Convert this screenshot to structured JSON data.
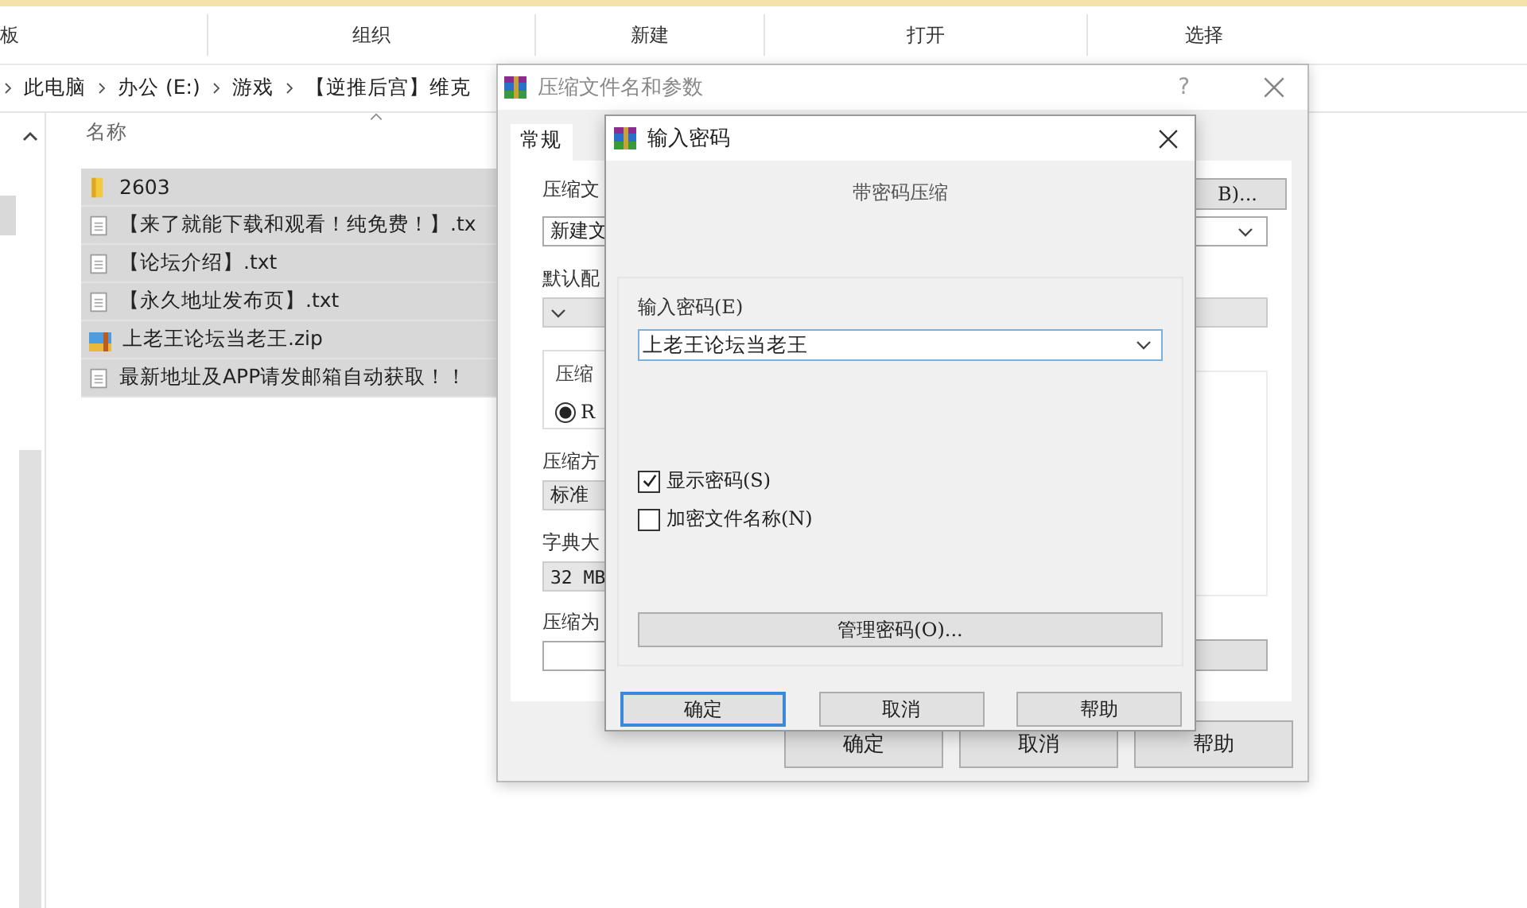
{
  "explorer": {
    "ribbon_groups": [
      "板",
      "组织",
      "新建",
      "打开",
      "选择"
    ],
    "breadcrumb": [
      "此电脑",
      "办公 (E:)",
      "游戏",
      "【逆推后宫】维克"
    ],
    "column_header": "名称",
    "files": [
      {
        "name": "2603",
        "kind": "folder",
        "selected": true
      },
      {
        "name": "【来了就能下载和观看！纯免费！】.tx",
        "kind": "text",
        "selected": true
      },
      {
        "name": "【论坛介绍】.txt",
        "kind": "text",
        "selected": true
      },
      {
        "name": "【永久地址发布页】.txt",
        "kind": "text",
        "selected": true
      },
      {
        "name": "上老王论坛当老王.zip",
        "kind": "archive",
        "selected": true
      },
      {
        "name": "最新地址及APP请发邮箱自动获取！！",
        "kind": "text",
        "selected": true
      }
    ]
  },
  "compress_dialog": {
    "title": "压缩文件名和参数",
    "help": "?",
    "tabs": [
      {
        "label": "常规",
        "selected": true
      }
    ],
    "archive_name_label": "压缩文",
    "archive_name_value": "新建文",
    "browse_button": "B)...",
    "profile_label": "默认配",
    "format_group_label": "压缩",
    "format_options": [
      {
        "label": "R",
        "selected": true
      }
    ],
    "method_label": "压缩方",
    "method_value": "标准",
    "dictionary_label": "字典大",
    "dictionary_value": "32 MB",
    "split_label": "压缩为",
    "buttons": [
      "确定",
      "取消",
      "帮助"
    ]
  },
  "password_dialog": {
    "title": "输入密码",
    "heading": "带密码压缩",
    "password_label": "输入密码(E)",
    "password_value": "上老王论坛当老王",
    "options": [
      {
        "label": "显示密码(S)",
        "checked": true
      },
      {
        "label": "加密文件名称(N)",
        "checked": false
      }
    ],
    "manage_button": "管理密码(O)...",
    "buttons": [
      {
        "label": "确定",
        "default": true
      },
      {
        "label": "取消",
        "default": false
      },
      {
        "label": "帮助",
        "default": false
      }
    ]
  }
}
